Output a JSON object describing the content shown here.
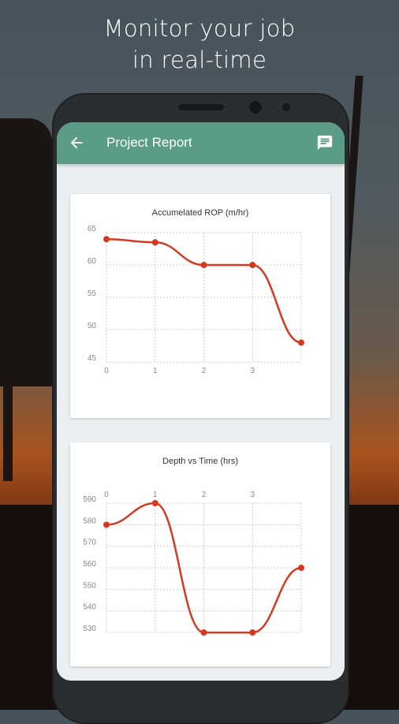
{
  "headline": {
    "line1": "Monitor your job",
    "line2": "in real-time"
  },
  "app_bar": {
    "title": "Project Report",
    "back_icon": "arrow-back-icon",
    "action_icon": "chat-icon"
  },
  "colors": {
    "app_bar": "#5b9c86",
    "series": "#d53a20",
    "grid": "#cccccc"
  },
  "chart_data": [
    {
      "type": "line",
      "title": "Accumelated ROP (m/hr)",
      "x": [
        0,
        1,
        2,
        3,
        4
      ],
      "x_tick_labels": [
        "0",
        "1",
        "2",
        "3"
      ],
      "y_tick_labels": [
        "65",
        "60",
        "55",
        "50",
        "45"
      ],
      "ylim": [
        45,
        65
      ],
      "series": [
        {
          "values": [
            64,
            63.5,
            60,
            60,
            48
          ]
        }
      ],
      "grid": true,
      "x_axis_position": "bottom"
    },
    {
      "type": "line",
      "title": "Depth vs Time (hrs)",
      "x": [
        0,
        1,
        2,
        3,
        4
      ],
      "x_tick_labels": [
        "0",
        "1",
        "2",
        "3"
      ],
      "y_tick_labels": [
        "590",
        "580",
        "570",
        "560",
        "550",
        "540",
        "530"
      ],
      "ylim": [
        530,
        590
      ],
      "series": [
        {
          "values": [
            580,
            590,
            530,
            530,
            560
          ]
        }
      ],
      "grid": true,
      "x_axis_position": "top"
    }
  ]
}
